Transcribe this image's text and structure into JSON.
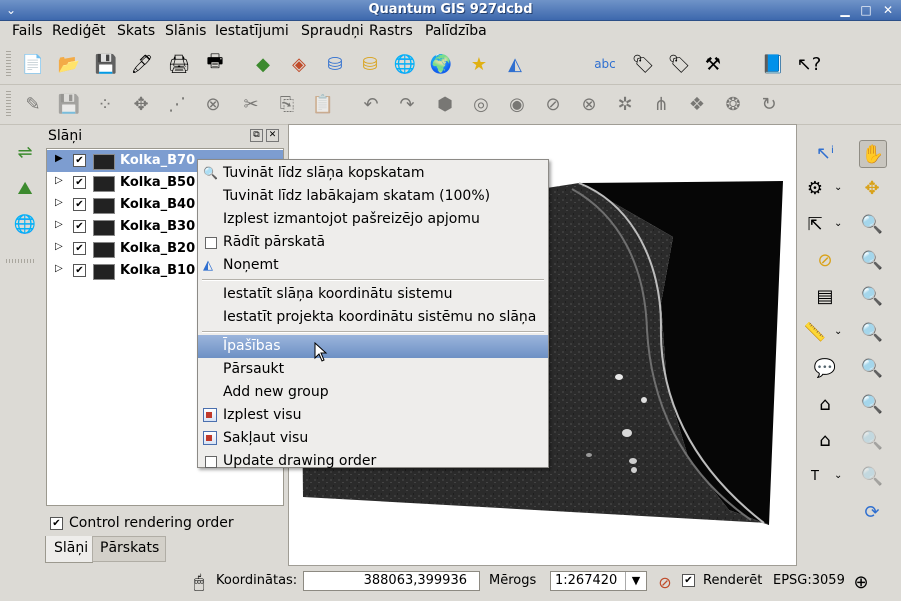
{
  "window": {
    "title": "Quantum GIS 927dcbd"
  },
  "menu": {
    "items": [
      "Fails",
      "Rediģēt",
      "Skats",
      "Slānis",
      "Iestatījumi",
      "Spraudņi",
      "Rastrs",
      "Palīdzība"
    ]
  },
  "layers_panel": {
    "title": "Slāņi",
    "layers": [
      {
        "name": "Kolka_B70",
        "checked": true,
        "selected": true
      },
      {
        "name": "Kolka_B50",
        "checked": true,
        "selected": false
      },
      {
        "name": "Kolka_B40",
        "checked": true,
        "selected": false
      },
      {
        "name": "Kolka_B30",
        "checked": true,
        "selected": false
      },
      {
        "name": "Kolka_B20",
        "checked": true,
        "selected": false
      },
      {
        "name": "Kolka_B10",
        "checked": true,
        "selected": false
      }
    ],
    "control_rendering_order": {
      "label": "Control rendering order",
      "checked": true
    },
    "tabs": [
      "Slāņi",
      "Pārskats"
    ],
    "active_tab": "Slāņi"
  },
  "context_menu": {
    "items": [
      {
        "label": "Tuvināt līdz slāņa kopskatam",
        "icon": "zoom-to-layer-icon"
      },
      {
        "label": "Tuvināt līdz labākajam skatam (100%)",
        "icon": ""
      },
      {
        "label": "Izplest izmantojot pašreizējo apjomu",
        "icon": ""
      },
      {
        "label": "Rādīt pārskatā",
        "icon": "checkbox"
      },
      {
        "label": "Noņemt",
        "icon": "remove-layer-icon"
      },
      {
        "label": "Iestatīt slāņa koordinātu sistemu",
        "icon": ""
      },
      {
        "label": "Iestatīt projekta koordinātu sistēmu no slāņa",
        "icon": ""
      },
      {
        "label": "Īpašības",
        "icon": "",
        "highlighted": true
      },
      {
        "label": "Pārsaukt",
        "icon": ""
      },
      {
        "label": "Add new group",
        "icon": ""
      },
      {
        "label": "Izplest visu",
        "icon": "expand-all-icon"
      },
      {
        "label": "Sakļaut visu",
        "icon": "collapse-all-icon"
      },
      {
        "label": "Update drawing order",
        "icon": "checkbox"
      }
    ]
  },
  "statusbar": {
    "coords_label": "Koordinātas:",
    "coords_value": "388063,399936",
    "scale_label": "Mērogs",
    "scale_value": "1:267420",
    "render_label": "Renderēt",
    "render_checked": true,
    "epsg": "EPSG:3059"
  },
  "colors": {
    "highlight": "#7d9dd0",
    "titlebar": "#4f77b8",
    "background": "#dcdad5"
  }
}
